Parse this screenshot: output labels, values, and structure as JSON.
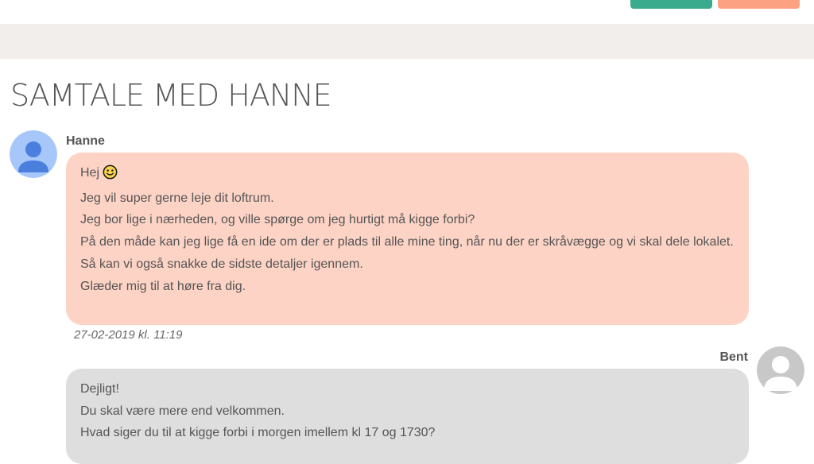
{
  "page": {
    "title": "SAMTALE MED HANNE"
  },
  "colors": {
    "accent_green": "#3aab8c",
    "accent_salmon": "#fca283",
    "band": "#f1eeec",
    "incoming_bubble": "#fdd3c5",
    "outgoing_bubble": "#dedede"
  },
  "messages": [
    {
      "sender": "Hanne",
      "avatar_icon": "user-avatar-blue-icon",
      "lines": [
        "Hej",
        "Jeg vil super gerne leje dit loftrum.",
        "Jeg bor lige i nærheden, og ville spørge om jeg hurtigt må kigge forbi?",
        "På den måde kan jeg lige få en ide om der er plads til alle mine ting, når nu der er skråvægge og vi skal dele lokalet.",
        "Så kan vi også snakke de sidste detaljer igennem.",
        "Glæder mig til at høre fra dig."
      ],
      "timestamp": "27-02-2019 kl. 11:19"
    },
    {
      "sender": "Bent",
      "avatar_icon": "user-avatar-gray-icon",
      "lines": [
        "Dejligt!",
        "Du skal være mere end velkommen.",
        "Hvad siger du til at kigge forbi i morgen imellem kl 17 og 1730?"
      ]
    }
  ]
}
